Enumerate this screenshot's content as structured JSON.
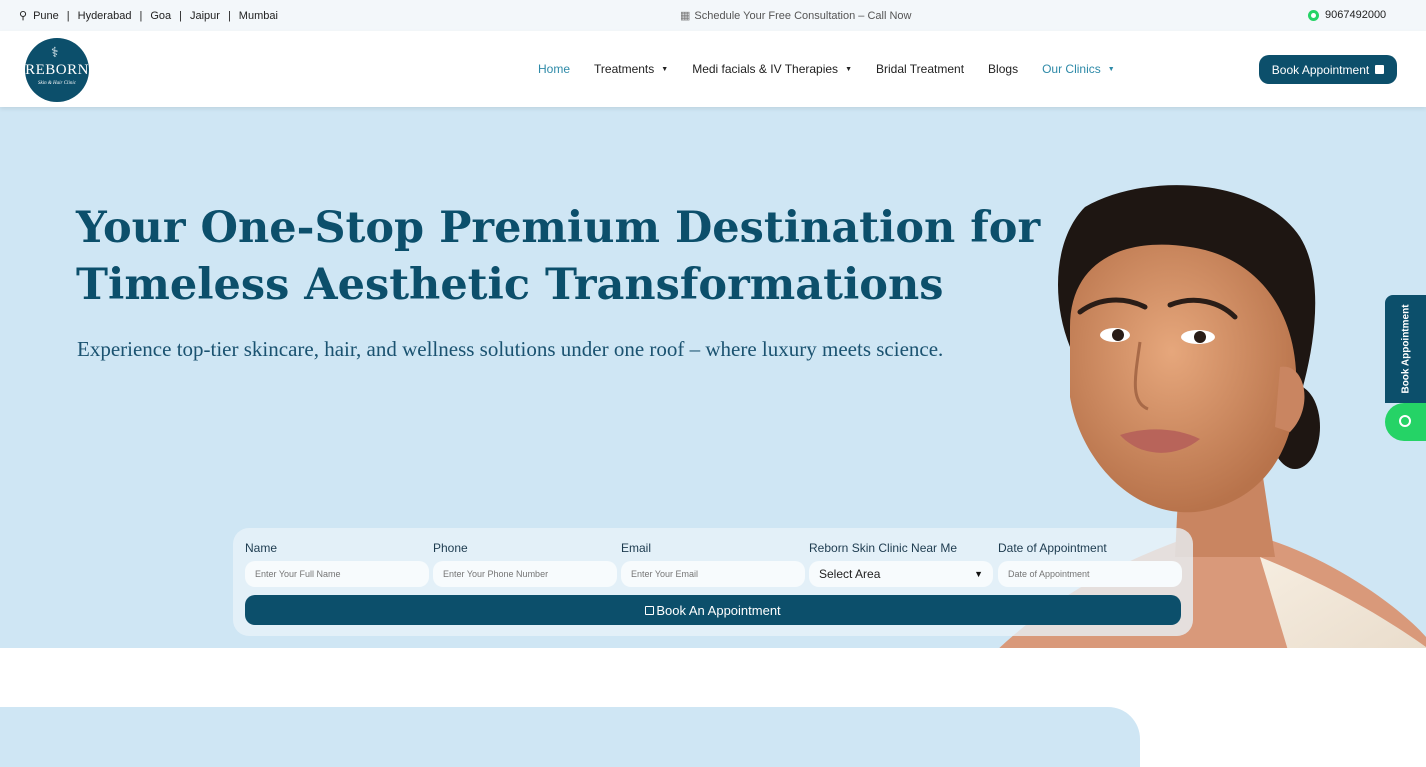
{
  "topbar": {
    "pin_icon": "location-pin-icon",
    "cities": [
      "Pune",
      "Hyderabad",
      "Goa",
      "Jaipur",
      "Mumbai"
    ],
    "separator": "|",
    "consultation_text": "Schedule Your Free Consultation – Call Now",
    "phone": "9067492000"
  },
  "header": {
    "logo": {
      "brand": "REBORN",
      "tagline": "Skin & Hair Clinic"
    },
    "nav": [
      {
        "label": "Home",
        "active": true
      },
      {
        "label": "Treatments",
        "dropdown": true
      },
      {
        "label": "Medi facials & IV Therapies",
        "dropdown": true
      },
      {
        "label": "Bridal Treatment"
      },
      {
        "label": "Blogs"
      },
      {
        "label": "Our Clinics",
        "active": true,
        "dropdown": true
      }
    ],
    "cta_label": "Book Appointment"
  },
  "hero": {
    "headline_line1": "Your One-Stop Premium Destination for",
    "headline_line2": "Timeless Aesthetic Transformations",
    "subheadline": "Experience top-tier skincare, hair, and wellness solutions under one roof – where luxury meets science."
  },
  "form": {
    "name": {
      "label": "Name",
      "placeholder": "Enter Your Full Name"
    },
    "phone": {
      "label": "Phone",
      "placeholder": "Enter Your Phone Number"
    },
    "email": {
      "label": "Email",
      "placeholder": "Enter Your Email"
    },
    "clinic": {
      "label": "Reborn Skin Clinic Near Me",
      "selected": "Select Area"
    },
    "date": {
      "label": "Date of Appointment",
      "placeholder": "Date of Appointment"
    },
    "submit_label": "Book An Appointment"
  },
  "side": {
    "tab_label": "Book Appointment"
  },
  "colors": {
    "brand": "#0c4f6b",
    "hero_bg": "#cfe6f4",
    "accent": "#2e8aa8",
    "whatsapp": "#25d366"
  }
}
